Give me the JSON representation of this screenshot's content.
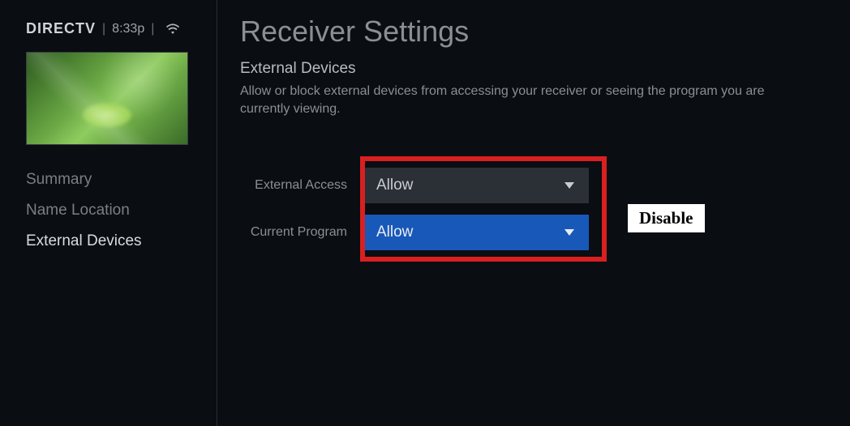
{
  "header": {
    "brand": "DIRECTV",
    "time": "8:33p"
  },
  "sidebar": {
    "items": [
      {
        "label": "Summary",
        "active": false
      },
      {
        "label": "Name Location",
        "active": false
      },
      {
        "label": "External Devices",
        "active": true
      }
    ]
  },
  "main": {
    "title": "Receiver Settings",
    "subtitle": "External Devices",
    "description": "Allow or block external devices from accessing your receiver or seeing the program you are currently viewing."
  },
  "settings": {
    "external_access": {
      "label": "External Access",
      "value": "Allow"
    },
    "current_program": {
      "label": "Current Program",
      "value": "Allow"
    }
  },
  "callout": "Disable"
}
